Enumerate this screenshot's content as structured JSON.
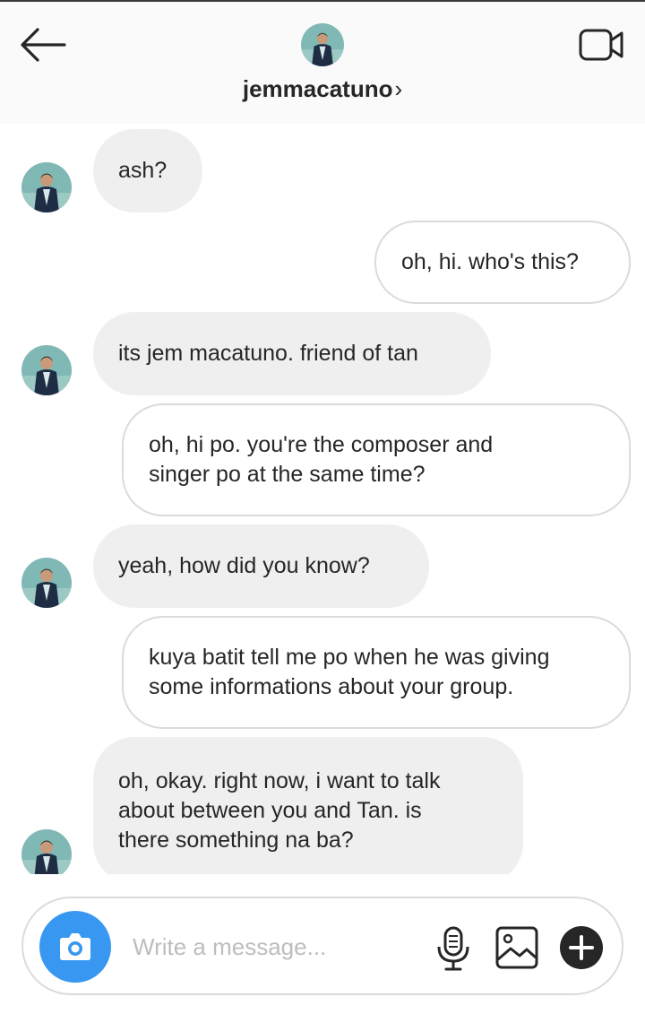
{
  "header": {
    "username": "jemmacatuno",
    "chevron": "›",
    "back_icon": "arrow-left-icon",
    "video_icon": "video-camera-icon"
  },
  "messages": [
    {
      "side": "in",
      "text": "ash?"
    },
    {
      "side": "out",
      "text": "oh, hi. who's this?"
    },
    {
      "side": "in",
      "text": "its jem macatuno. friend of tan"
    },
    {
      "side": "out",
      "line1": "oh, hi po. you're the composer and",
      "line2": "singer po at the same time?"
    },
    {
      "side": "in",
      "text": "yeah, how did you know?"
    },
    {
      "side": "out",
      "line1": "kuya batit tell me po when he was giving",
      "line2": "some informations about your group."
    },
    {
      "side": "in",
      "line1": "oh, okay. right now, i want to talk",
      "line2": "about between you and Tan. is",
      "line3": "there something na ba?"
    }
  ],
  "composer": {
    "placeholder": "Write a message...",
    "value": ""
  },
  "colors": {
    "accent": "#3897f0",
    "incoming_bubble": "#efefef",
    "outgoing_border": "#dbdbdb",
    "header_bg": "#fafafa"
  }
}
